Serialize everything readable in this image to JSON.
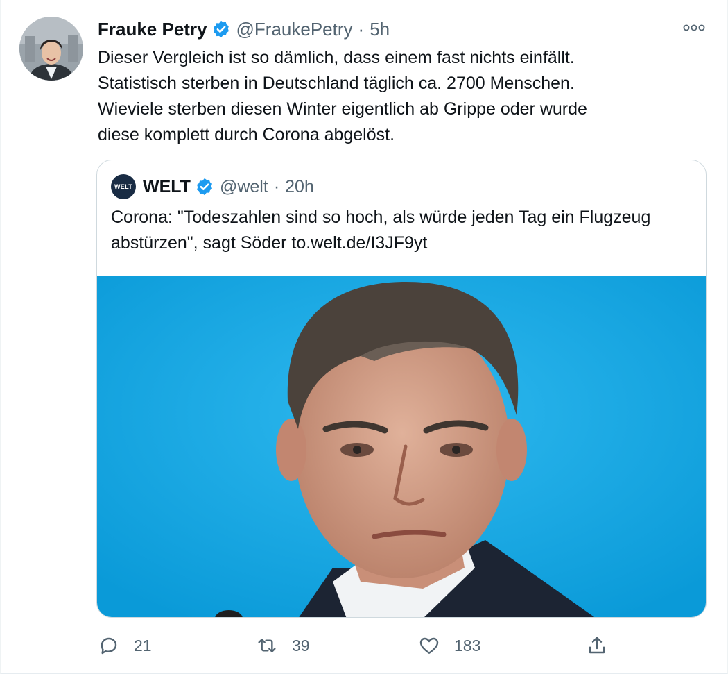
{
  "tweet": {
    "author_name": "Frauke Petry",
    "handle": "@FraukePetry",
    "separator": "·",
    "time": "5h",
    "text": "Dieser Vergleich ist so dämlich, dass einem fast nichts einfällt.\nStatistisch sterben in Deutschland täglich ca. 2700 Menschen.\nWieviele sterben diesen Winter eigentlich ab Grippe oder wurde\ndiese komplett durch Corona abgelöst."
  },
  "quoted": {
    "avatar_text": "WELT",
    "author_name": "WELT",
    "handle": "@welt",
    "separator": "·",
    "time": "20h",
    "text": "Corona: \"Todeszahlen sind so hoch, als würde jeden Tag ein Flugzeug abstürzen\", sagt Söder to.welt.de/I3JF9yt"
  },
  "actions": {
    "reply_count": "21",
    "retweet_count": "39",
    "like_count": "183"
  },
  "icons": {
    "verified": "verified-badge-icon",
    "more": "more-options-icon",
    "reply": "reply-icon",
    "retweet": "retweet-icon",
    "like": "heart-icon",
    "share": "share-icon"
  },
  "colors": {
    "verified_blue": "#1d9bf0",
    "photo_background": "#12a9e6",
    "muted_text": "#536471"
  }
}
